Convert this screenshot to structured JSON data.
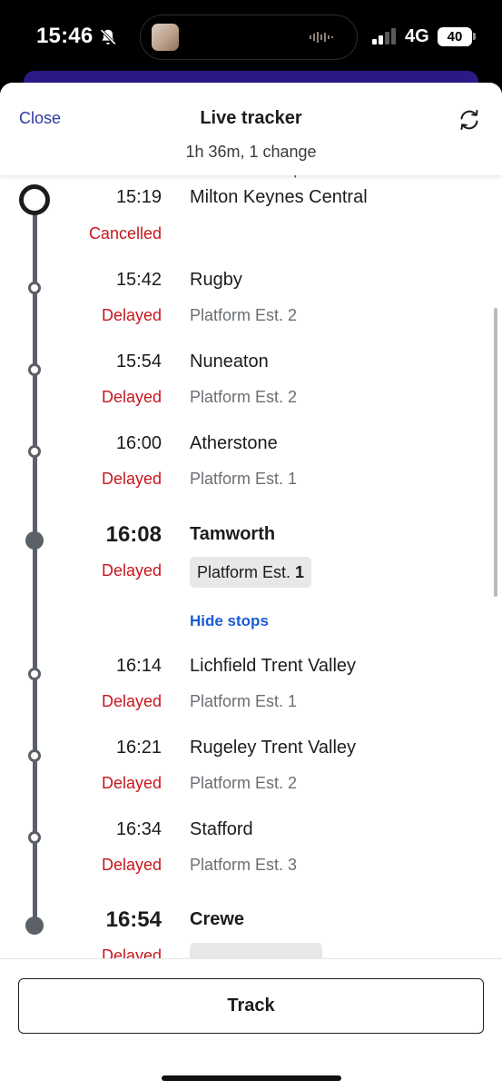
{
  "status_bar": {
    "time": "15:46",
    "network": "4G",
    "battery": "40",
    "icons": [
      "bell-slash-icon",
      "signal-bars-icon",
      "waveform-icon"
    ]
  },
  "header": {
    "close_label": "Close",
    "title": "Live tracker",
    "subtitle": "1h 36m, 1 change",
    "refresh_icon": "refresh-icon"
  },
  "hide_earlier_label": "Hide earlier stops",
  "stops": [
    {
      "time": "15:19",
      "name": "Milton Keynes Central",
      "status": "Cancelled",
      "platform": ""
    },
    {
      "time": "15:42",
      "name": "Rugby",
      "status": "Delayed",
      "platform": "Platform Est. 2"
    },
    {
      "time": "15:54",
      "name": "Nuneaton",
      "status": "Delayed",
      "platform": "Platform Est. 2"
    },
    {
      "time": "16:00",
      "name": "Atherstone",
      "status": "Delayed",
      "platform": "Platform Est. 1"
    },
    {
      "time": "16:08",
      "name": "Tamworth",
      "status": "Delayed",
      "platform_prefix": "Platform Est. ",
      "platform_number": "1"
    },
    {
      "time": "16:14",
      "name": "Lichfield Trent Valley",
      "status": "Delayed",
      "platform": "Platform Est. 1"
    },
    {
      "time": "16:21",
      "name": "Rugeley Trent Valley",
      "status": "Delayed",
      "platform": "Platform Est. 2"
    },
    {
      "time": "16:34",
      "name": "Stafford",
      "status": "Delayed",
      "platform": "Platform Est. 3"
    },
    {
      "time": "16:54",
      "name": "Crewe",
      "status": "Delayed",
      "platform": ""
    }
  ],
  "hide_stops_label": "Hide stops",
  "footer": {
    "track_label": "Track"
  },
  "colors": {
    "accent_blue": "#1a5bd6",
    "close_blue": "#2b3a9e",
    "delay_red": "#c8161d",
    "rail_grey": "#5b6166"
  }
}
